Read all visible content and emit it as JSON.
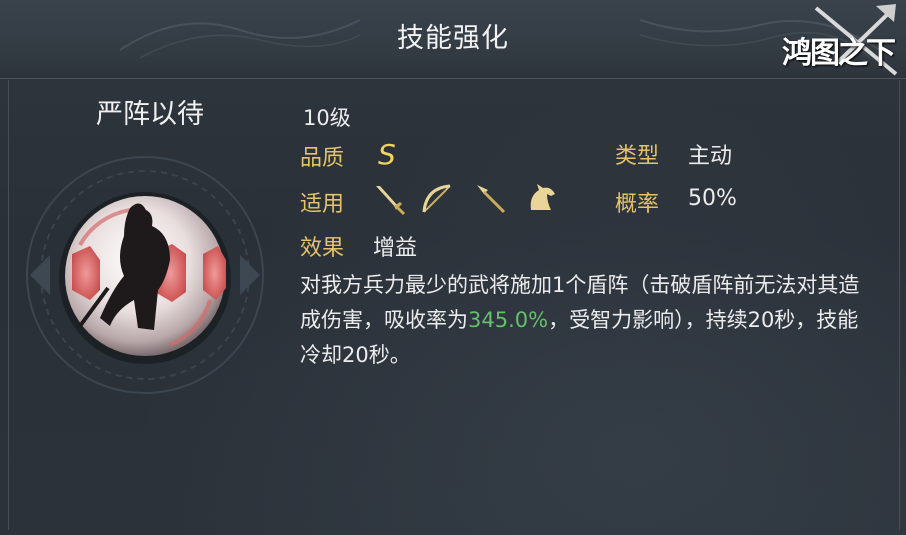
{
  "header": {
    "title": "技能强化",
    "logo_text": "鸿图之下"
  },
  "skill": {
    "name": "严阵以待",
    "level": "10级",
    "quality_label": "品质",
    "quality_value": "S",
    "type_label": "类型",
    "type_value": "主动",
    "applicable_label": "适用",
    "applicable_icons": [
      "sword-icon",
      "bow-icon",
      "spear-icon",
      "horse-icon"
    ],
    "probability_label": "概率",
    "probability_value": "50%",
    "effect_label": "效果",
    "effect_value": "增益",
    "description_part1": "对我方兵力最少的武将施加1个盾阵（击破盾阵前无法对其造成伤害，吸收率为",
    "description_highlight": "345.0%",
    "description_part2": "，受智力影响），持续20秒，技能冷却20秒。"
  },
  "colors": {
    "label_gold": "#e4c36a",
    "grade_yellow": "#f3d55c",
    "highlight_green": "#63c06b",
    "background": "#2a3139"
  }
}
